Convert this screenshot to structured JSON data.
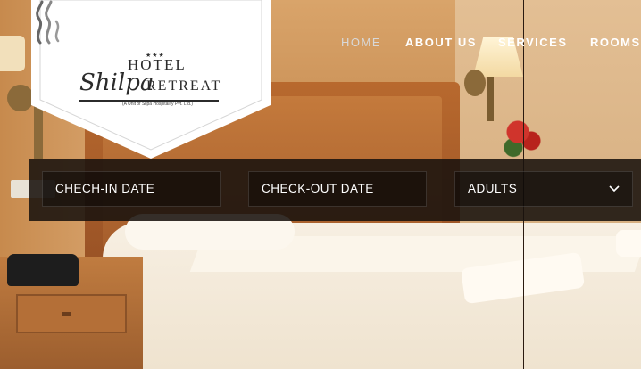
{
  "logo": {
    "stars": "★★★",
    "hotel": "HOTEL",
    "name_script": "Shilpa",
    "name_caps": "RETREAT",
    "tagline": "(A Unit of Silpa Hospitality Pvt. Ltd.)"
  },
  "nav": {
    "items": [
      {
        "label": "HOME",
        "active": true
      },
      {
        "label": "ABOUT US",
        "active": false
      },
      {
        "label": "SERVICES",
        "active": false
      },
      {
        "label": "ROOMS",
        "active": false
      }
    ]
  },
  "booking": {
    "checkin_label": "CHECH-IN DATE",
    "checkout_label": "CHECK-OUT DATE",
    "adults_label": "ADULTS"
  },
  "icons": {
    "logo_mark": "steam-flame-icon",
    "dropdown": "chevron-down-icon"
  },
  "colors": {
    "nav_text": "#ffffff",
    "nav_active": "#d8d8d8",
    "bar_bg": "#19120e",
    "logo_text": "#2b2b2b"
  }
}
